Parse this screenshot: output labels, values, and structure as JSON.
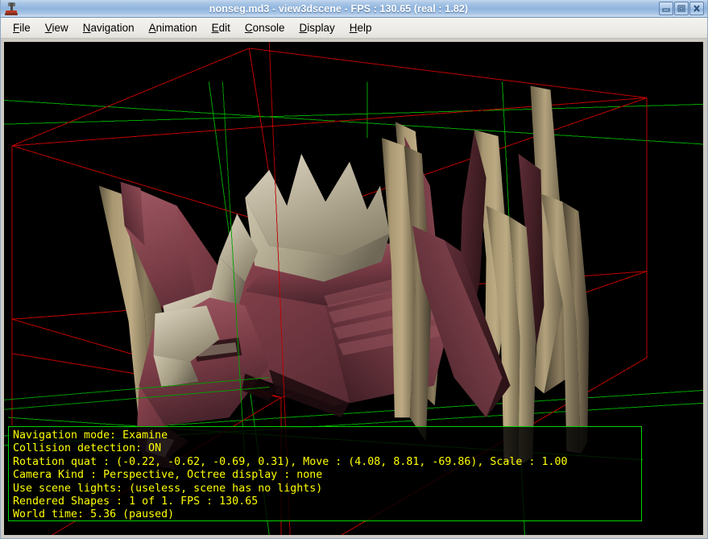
{
  "window": {
    "title": "nonseg.md3 - view3dscene - FPS : 130.65 (real : 1.82)",
    "icon": "joystick-icon",
    "controls": {
      "minimize": "minimize-icon",
      "maximize": "maximize-icon",
      "close": "close-icon"
    }
  },
  "menubar": {
    "items": [
      {
        "label": "File",
        "accel": "F",
        "rest": "ile"
      },
      {
        "label": "View",
        "accel": "V",
        "rest": "iew"
      },
      {
        "label": "Navigation",
        "accel": "N",
        "rest": "avigation"
      },
      {
        "label": "Animation",
        "accel": "A",
        "rest": "nimation"
      },
      {
        "label": "Edit",
        "accel": "E",
        "rest": "dit"
      },
      {
        "label": "Console",
        "accel": "C",
        "rest": "onsole"
      },
      {
        "label": "Display",
        "accel": "D",
        "rest": "isplay"
      },
      {
        "label": "Help",
        "accel": "H",
        "rest": "elp"
      }
    ]
  },
  "viewport": {
    "background": "#000000",
    "bounding_box_color": "#cc0000",
    "axis_grid_color": "#00a800",
    "model": "quake3-md3-creature"
  },
  "status": {
    "border_color": "#00d400",
    "text_color": "#ffff00",
    "lines": [
      "Navigation mode: Examine",
      "Collision detection: ON",
      "Rotation quat : (-0.22, -0.62, -0.69, 0.31), Move : (4.08, 8.81, -69.86), Scale : 1.00",
      "Camera Kind : Perspective, Octree display : none",
      "Use scene lights: (useless, scene has no lights)",
      "Rendered Shapes : 1 of 1. FPS : 130.65",
      "World time: 5.36 (paused)"
    ],
    "fields": {
      "navigation_mode": "Examine",
      "collision_detection": "ON",
      "rotation_quat": [
        -0.22,
        -0.62,
        -0.69,
        0.31
      ],
      "move": [
        4.08,
        8.81,
        -69.86
      ],
      "scale": 1.0,
      "camera_kind": "Perspective",
      "octree_display": "none",
      "scene_lights": "(useless, scene has no lights)",
      "rendered_shapes": "1 of 1",
      "fps": 130.65,
      "world_time": 5.36,
      "paused": true
    }
  }
}
